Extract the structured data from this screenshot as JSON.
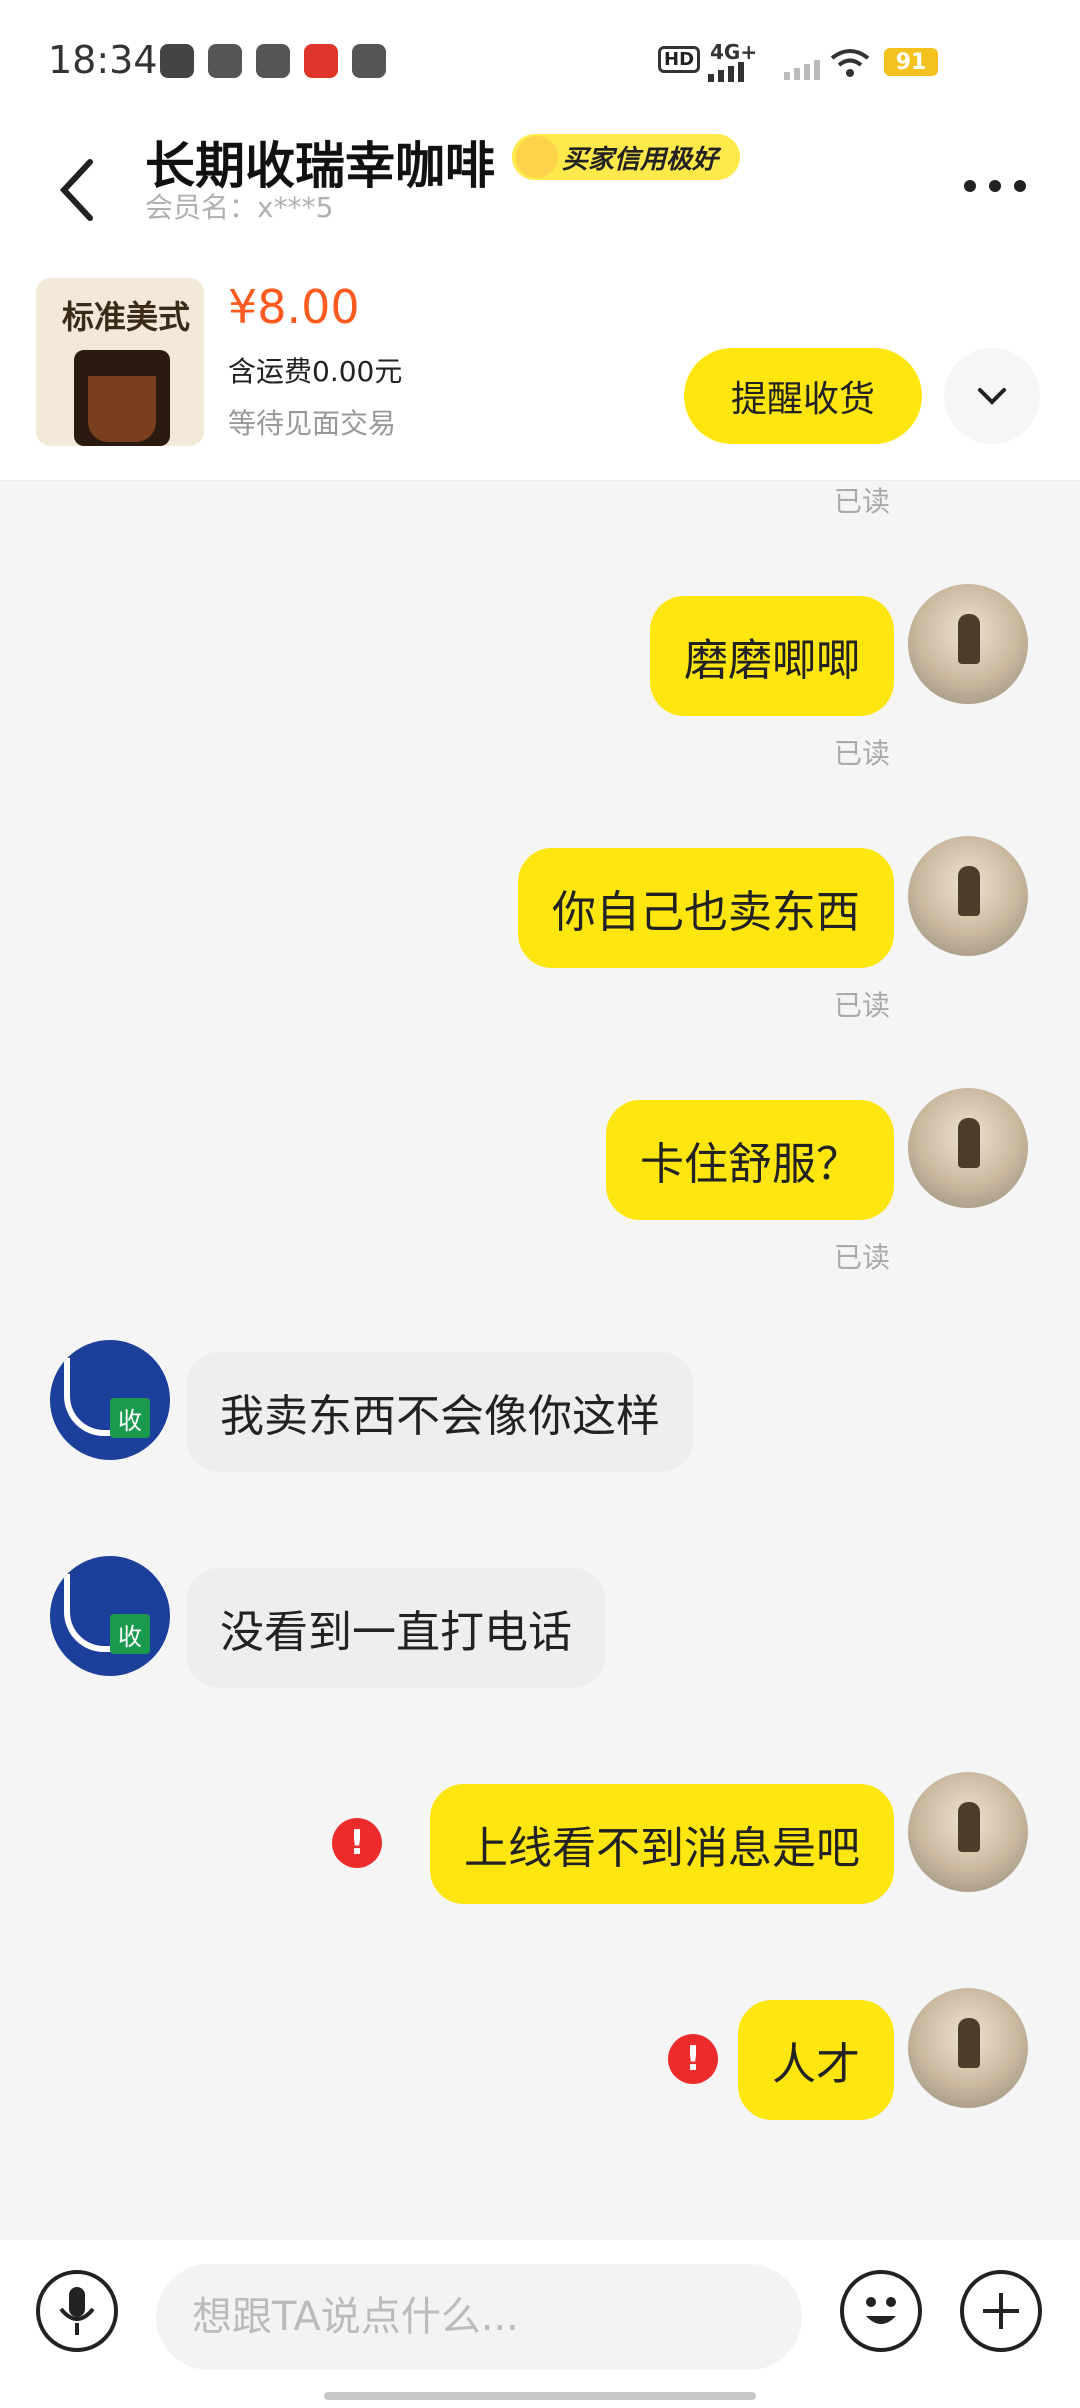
{
  "status_bar": {
    "time": "18:34",
    "network": "4G+",
    "battery": "91",
    "hd_label": "HD"
  },
  "header": {
    "title": "长期收瑞幸咖啡",
    "credit_badge": "买家信用极好",
    "member": "会员名：x***5"
  },
  "product": {
    "image_label": "标准美式",
    "price": "¥8.00",
    "shipping": "含运费0.00元",
    "status": "等待见面交易",
    "remind_button": "提醒收货"
  },
  "messages": [
    {
      "from": "me",
      "text": "",
      "read": "已读"
    },
    {
      "from": "me",
      "text": "磨磨唧唧",
      "read": "已读"
    },
    {
      "from": "me",
      "text": "你自己也卖东西",
      "read": "已读"
    },
    {
      "from": "me",
      "text": "卡住舒服？",
      "read": "已读"
    },
    {
      "from": "other",
      "text": "我卖东西不会像你这样"
    },
    {
      "from": "other",
      "text": "没看到一直打电话"
    },
    {
      "from": "me",
      "text": "上线看不到消息是吧",
      "error": "!"
    },
    {
      "from": "me",
      "text": "人才",
      "error": "!"
    }
  ],
  "other_avatar_badge": "收",
  "input": {
    "placeholder": "想跟TA说点什么..."
  }
}
